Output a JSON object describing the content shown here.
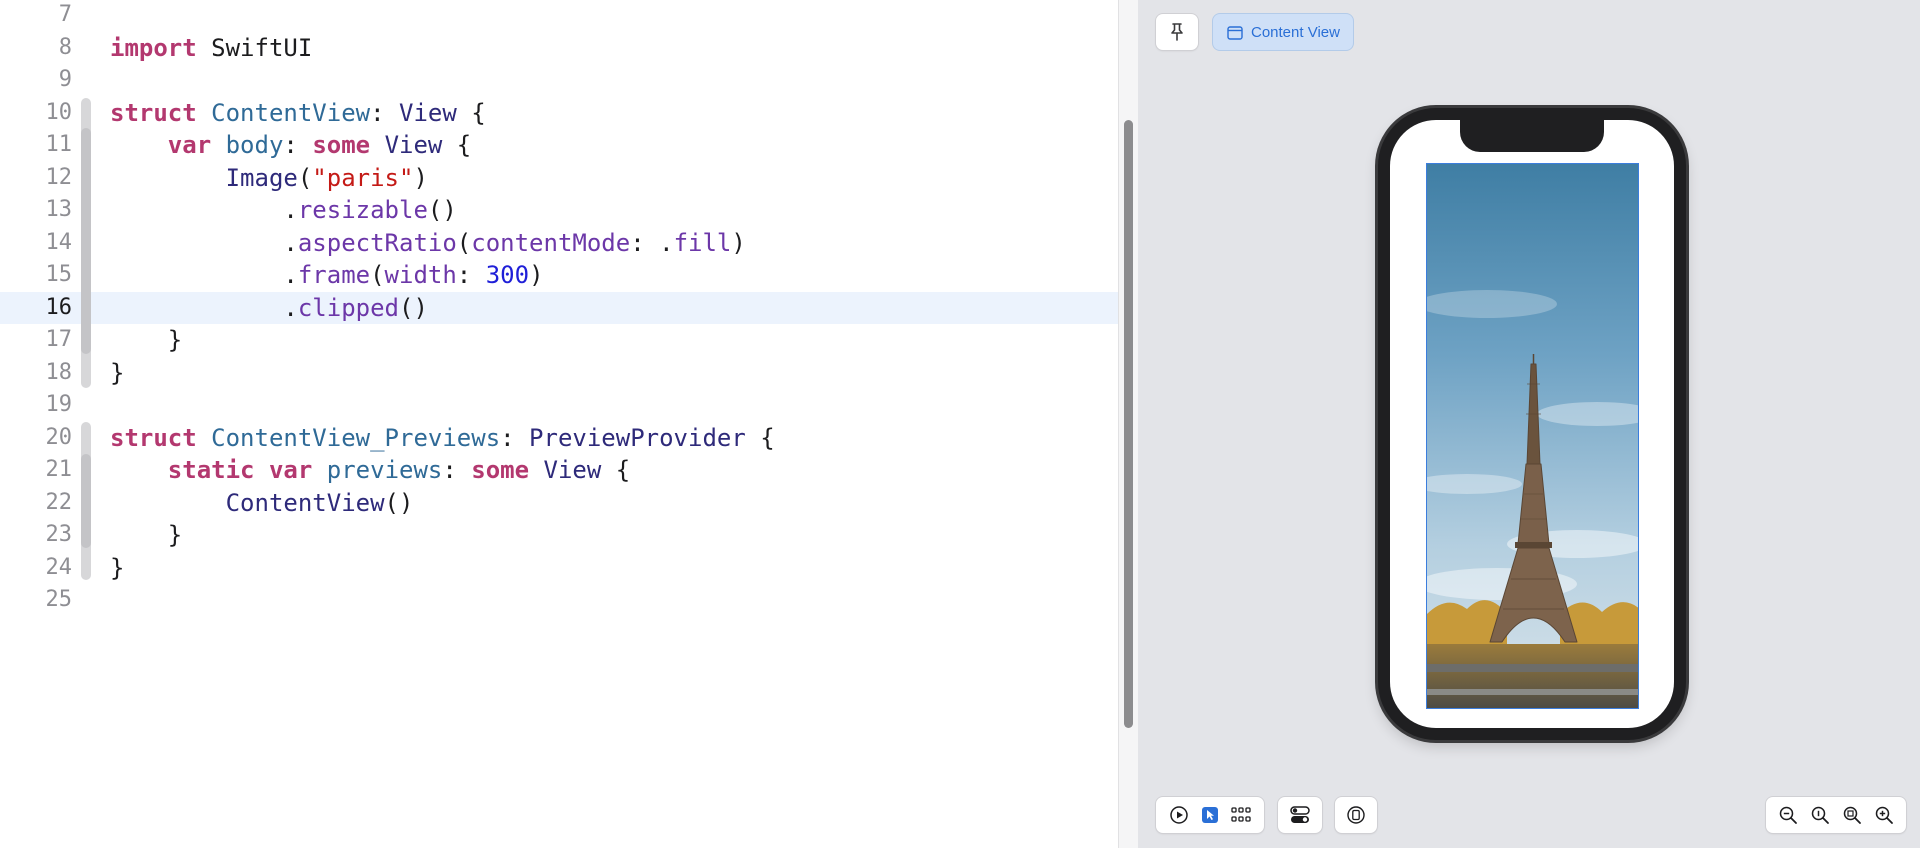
{
  "editor": {
    "active_line": "16",
    "lines": [
      {
        "number": "7",
        "tokens": []
      },
      {
        "number": "8",
        "tokens": [
          {
            "t": "import",
            "c": "kw"
          },
          {
            "t": " SwiftUI",
            "c": "plain"
          }
        ]
      },
      {
        "number": "9",
        "tokens": []
      },
      {
        "number": "10",
        "tokens": [
          {
            "t": "struct",
            "c": "kw"
          },
          {
            "t": " ",
            "c": "plain"
          },
          {
            "t": "ContentView",
            "c": "decl"
          },
          {
            "t": ": ",
            "c": "plain"
          },
          {
            "t": "View",
            "c": "type"
          },
          {
            "t": " {",
            "c": "plain"
          }
        ]
      },
      {
        "number": "11",
        "tokens": [
          {
            "t": "    ",
            "c": "plain"
          },
          {
            "t": "var",
            "c": "kw"
          },
          {
            "t": " ",
            "c": "plain"
          },
          {
            "t": "body",
            "c": "decl"
          },
          {
            "t": ": ",
            "c": "plain"
          },
          {
            "t": "some",
            "c": "kw"
          },
          {
            "t": " ",
            "c": "plain"
          },
          {
            "t": "View",
            "c": "type"
          },
          {
            "t": " {",
            "c": "plain"
          }
        ]
      },
      {
        "number": "12",
        "tokens": [
          {
            "t": "        ",
            "c": "plain"
          },
          {
            "t": "Image",
            "c": "type"
          },
          {
            "t": "(",
            "c": "plain"
          },
          {
            "t": "\"paris\"",
            "c": "str"
          },
          {
            "t": ")",
            "c": "plain"
          }
        ]
      },
      {
        "number": "13",
        "tokens": [
          {
            "t": "            .",
            "c": "plain"
          },
          {
            "t": "resizable",
            "c": "meth"
          },
          {
            "t": "()",
            "c": "plain"
          }
        ]
      },
      {
        "number": "14",
        "tokens": [
          {
            "t": "            .",
            "c": "plain"
          },
          {
            "t": "aspectRatio",
            "c": "meth"
          },
          {
            "t": "(",
            "c": "plain"
          },
          {
            "t": "contentMode",
            "c": "meth"
          },
          {
            "t": ": .",
            "c": "plain"
          },
          {
            "t": "fill",
            "c": "meth"
          },
          {
            "t": ")",
            "c": "plain"
          }
        ]
      },
      {
        "number": "15",
        "tokens": [
          {
            "t": "            .",
            "c": "plain"
          },
          {
            "t": "frame",
            "c": "meth"
          },
          {
            "t": "(",
            "c": "plain"
          },
          {
            "t": "width",
            "c": "meth"
          },
          {
            "t": ": ",
            "c": "plain"
          },
          {
            "t": "300",
            "c": "num"
          },
          {
            "t": ")",
            "c": "plain"
          }
        ]
      },
      {
        "number": "16",
        "tokens": [
          {
            "t": "            .",
            "c": "plain"
          },
          {
            "t": "clipped",
            "c": "meth"
          },
          {
            "t": "()",
            "c": "plain"
          }
        ]
      },
      {
        "number": "17",
        "tokens": [
          {
            "t": "    }",
            "c": "plain"
          }
        ]
      },
      {
        "number": "18",
        "tokens": [
          {
            "t": "}",
            "c": "plain"
          }
        ]
      },
      {
        "number": "19",
        "tokens": []
      },
      {
        "number": "20",
        "tokens": [
          {
            "t": "struct",
            "c": "kw"
          },
          {
            "t": " ",
            "c": "plain"
          },
          {
            "t": "ContentView_Previews",
            "c": "decl"
          },
          {
            "t": ": ",
            "c": "plain"
          },
          {
            "t": "PreviewProvider",
            "c": "type"
          },
          {
            "t": " {",
            "c": "plain"
          }
        ]
      },
      {
        "number": "21",
        "tokens": [
          {
            "t": "    ",
            "c": "plain"
          },
          {
            "t": "static",
            "c": "kw"
          },
          {
            "t": " ",
            "c": "plain"
          },
          {
            "t": "var",
            "c": "kw"
          },
          {
            "t": " ",
            "c": "plain"
          },
          {
            "t": "previews",
            "c": "decl"
          },
          {
            "t": ": ",
            "c": "plain"
          },
          {
            "t": "some",
            "c": "kw"
          },
          {
            "t": " ",
            "c": "plain"
          },
          {
            "t": "View",
            "c": "type"
          },
          {
            "t": " {",
            "c": "plain"
          }
        ]
      },
      {
        "number": "22",
        "tokens": [
          {
            "t": "        ",
            "c": "plain"
          },
          {
            "t": "ContentView",
            "c": "type"
          },
          {
            "t": "()",
            "c": "plain"
          }
        ]
      },
      {
        "number": "23",
        "tokens": [
          {
            "t": "    }",
            "c": "plain"
          }
        ]
      },
      {
        "number": "24",
        "tokens": [
          {
            "t": "}",
            "c": "plain"
          }
        ]
      },
      {
        "number": "25",
        "tokens": []
      }
    ]
  },
  "preview": {
    "content_view_label": "Content View",
    "icons": {
      "pin": "pin-icon",
      "content_view": "window-icon",
      "live": "play-icon",
      "selectable": "cursor-icon",
      "grid": "grid-icon",
      "variants": "toggles-icon",
      "device_settings": "device-settings-icon",
      "zoom_out": "zoom-out-icon",
      "zoom_actual": "zoom-actual-icon",
      "zoom_fit": "zoom-fit-icon",
      "zoom_in": "zoom-in-icon"
    },
    "photo": "Eiffel Tower, Paris"
  },
  "colors": {
    "keyword": "#b3386f",
    "declaration": "#2f6a97",
    "type": "#2e2a7a",
    "string": "#c41a16",
    "method": "#6c37a8",
    "number": "#1f1fd8",
    "active_line_bg": "#ecf3fd",
    "canvas_bg": "#e3e4e8",
    "accent": "#2a6fd6"
  }
}
